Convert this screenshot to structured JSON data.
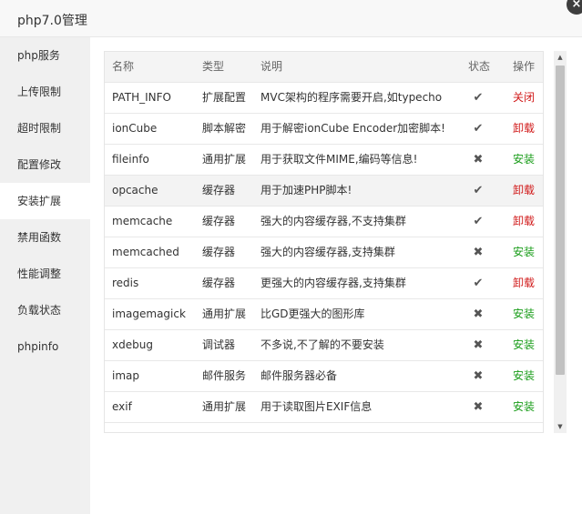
{
  "title": "php7.0管理",
  "close_icon": "×",
  "sidebar": {
    "items": [
      {
        "label": "php服务"
      },
      {
        "label": "上传限制"
      },
      {
        "label": "超时限制"
      },
      {
        "label": "配置修改"
      },
      {
        "label": "安装扩展"
      },
      {
        "label": "禁用函数"
      },
      {
        "label": "性能调整"
      },
      {
        "label": "负载状态"
      },
      {
        "label": "phpinfo"
      }
    ],
    "active_index": 4
  },
  "table": {
    "headers": {
      "name": "名称",
      "type": "类型",
      "desc": "说明",
      "status": "状态",
      "action": "操作"
    },
    "rows": [
      {
        "name": "PATH_INFO",
        "type": "扩展配置",
        "desc": "MVC架构的程序需要开启,如typecho",
        "status": "✔",
        "action": "关闭",
        "action_color": "red"
      },
      {
        "name": "ionCube",
        "type": "脚本解密",
        "desc": "用于解密ionCube Encoder加密脚本!",
        "status": "✔",
        "action": "卸载",
        "action_color": "red"
      },
      {
        "name": "fileinfo",
        "type": "通用扩展",
        "desc": "用于获取文件MIME,编码等信息!",
        "status": "✖",
        "action": "安装",
        "action_color": "green"
      },
      {
        "name": "opcache",
        "type": "缓存器",
        "desc": "用于加速PHP脚本!",
        "status": "✔",
        "action": "卸载",
        "action_color": "red"
      },
      {
        "name": "memcache",
        "type": "缓存器",
        "desc": "强大的内容缓存器,不支持集群",
        "status": "✔",
        "action": "卸载",
        "action_color": "red"
      },
      {
        "name": "memcached",
        "type": "缓存器",
        "desc": "强大的内容缓存器,支持集群",
        "status": "✖",
        "action": "安装",
        "action_color": "green"
      },
      {
        "name": "redis",
        "type": "缓存器",
        "desc": "更强大的内容缓存器,支持集群",
        "status": "✔",
        "action": "卸载",
        "action_color": "red"
      },
      {
        "name": "imagemagick",
        "type": "通用扩展",
        "desc": "比GD更强大的图形库",
        "status": "✖",
        "action": "安装",
        "action_color": "green"
      },
      {
        "name": "xdebug",
        "type": "调试器",
        "desc": "不多说,不了解的不要安装",
        "status": "✖",
        "action": "安装",
        "action_color": "green"
      },
      {
        "name": "imap",
        "type": "邮件服务",
        "desc": "邮件服务器必备",
        "status": "✖",
        "action": "安装",
        "action_color": "green"
      },
      {
        "name": "exif",
        "type": "通用扩展",
        "desc": "用于读取图片EXIF信息",
        "status": "✖",
        "action": "安装",
        "action_color": "green"
      }
    ],
    "hover_row_index": 3
  },
  "scrollbar": {
    "up_icon": "▲",
    "down_icon": "▼"
  },
  "colors": {
    "action_red": "#d11b1b",
    "action_green": "#1a9d1a",
    "sidebar_bg": "#f0f0f0",
    "header_bg": "#f4f4f4"
  }
}
